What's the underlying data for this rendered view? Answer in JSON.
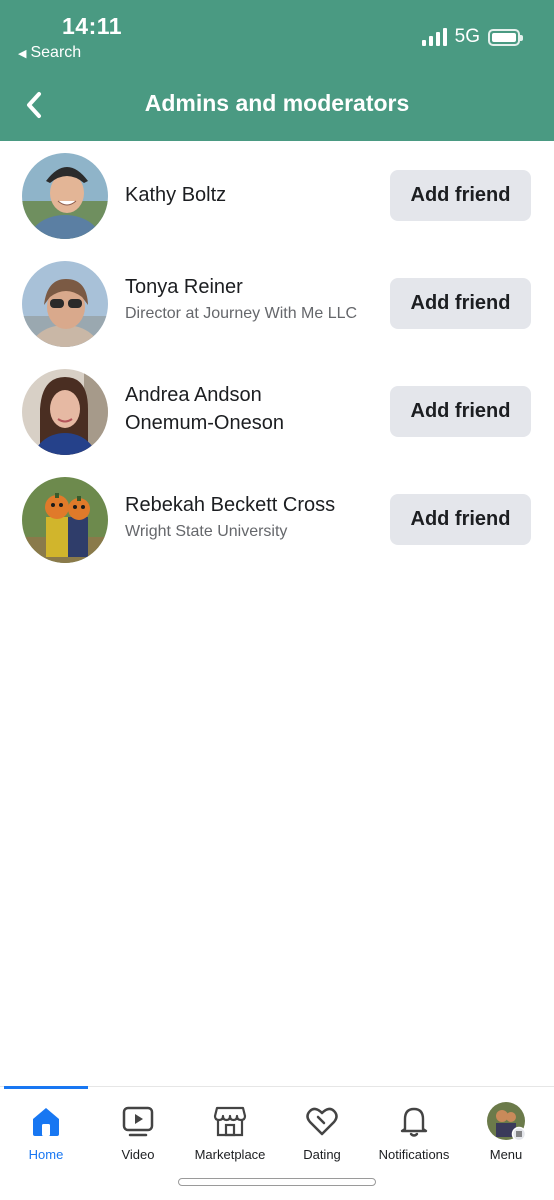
{
  "status_bar": {
    "time": "14:11",
    "back_app": "Search",
    "network": "5G"
  },
  "header": {
    "title": "Admins and moderators",
    "color": "#4a9a82"
  },
  "people": [
    {
      "name": "Kathy Boltz",
      "subtitle": "",
      "button": "Add friend"
    },
    {
      "name": "Tonya Reiner",
      "subtitle": "Director at Journey With Me LLC",
      "button": "Add friend"
    },
    {
      "name": "Andrea Andson Onemum-Oneson",
      "subtitle": "",
      "button": "Add friend"
    },
    {
      "name": "Rebekah Beckett Cross",
      "subtitle": "Wright State University",
      "button": "Add friend"
    }
  ],
  "tabbar": {
    "active_color": "#1877f2",
    "tabs": [
      {
        "label": "Home",
        "icon": "home-icon"
      },
      {
        "label": "Video",
        "icon": "video-icon"
      },
      {
        "label": "Marketplace",
        "icon": "marketplace-icon"
      },
      {
        "label": "Dating",
        "icon": "dating-icon"
      },
      {
        "label": "Notifications",
        "icon": "bell-icon"
      },
      {
        "label": "Menu",
        "icon": "profile-avatar"
      }
    ]
  }
}
